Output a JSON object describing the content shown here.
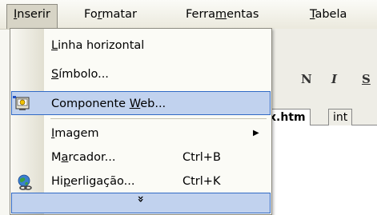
{
  "menubar": {
    "items": [
      {
        "pre": "",
        "u": "I",
        "post": "nserir"
      },
      {
        "pre": "Fo",
        "u": "r",
        "post": "matar"
      },
      {
        "pre": "Ferra",
        "u": "m",
        "post": "entas"
      },
      {
        "pre": "",
        "u": "T",
        "post": "abela"
      }
    ]
  },
  "toolbar": {
    "bold": "N",
    "italic": "I",
    "underline": "S"
  },
  "doc_tabs": [
    "x.htm",
    "int"
  ],
  "menu": {
    "items": [
      {
        "pre": "",
        "u": "L",
        "post": "inha horizontal",
        "shortcut": ""
      },
      {
        "pre": "",
        "u": "S",
        "post": "ímbolo...",
        "shortcut": ""
      },
      {
        "pre": "Componente ",
        "u": "W",
        "post": "eb...",
        "shortcut": ""
      },
      {
        "pre": "",
        "u": "I",
        "post": "magem",
        "shortcut": ""
      },
      {
        "pre": "M",
        "u": "a",
        "post": "rcador...",
        "shortcut": "Ctrl+B"
      },
      {
        "pre": "Hi",
        "u": "p",
        "post": "erligação...",
        "shortcut": "Ctrl+K"
      }
    ],
    "expand_glyph": "»"
  },
  "colors": {
    "highlight": "#c1d2ee",
    "highlight_border": "#316ac5"
  }
}
